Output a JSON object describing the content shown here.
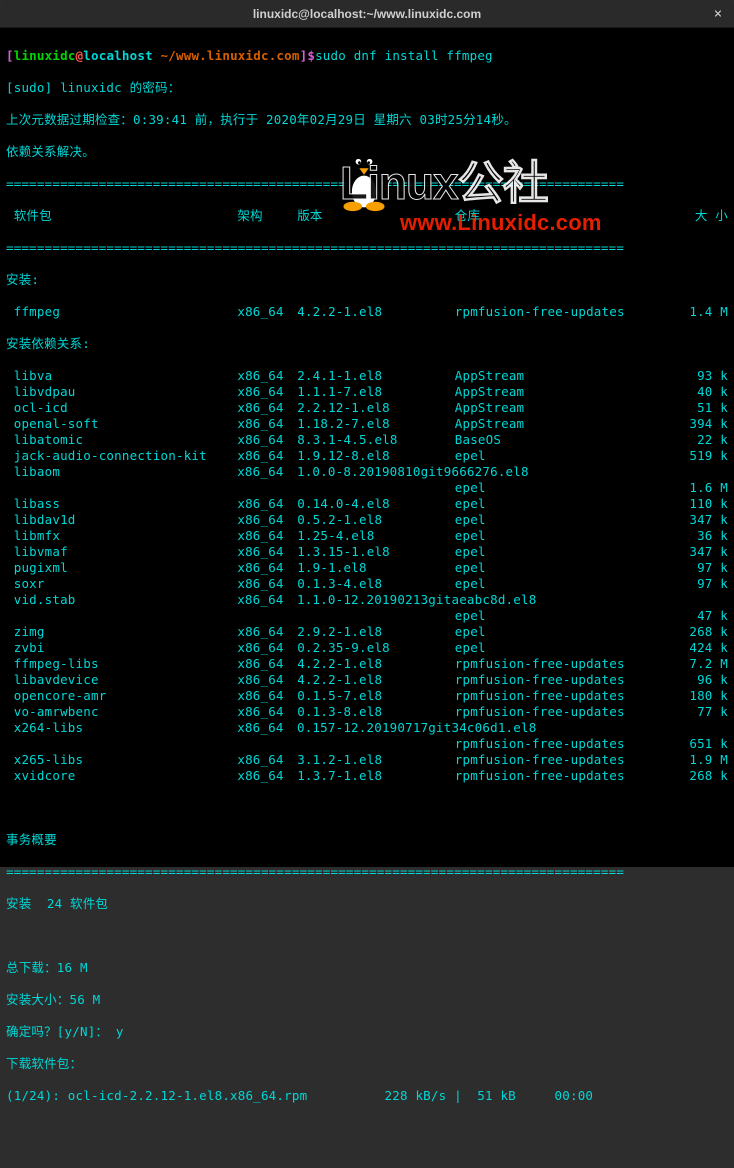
{
  "titlebar": {
    "title": "linuxidc@localhost:~/www.linuxidc.com",
    "close": "×"
  },
  "prompt": {
    "lb": "[",
    "user": "linuxidc",
    "at": "@",
    "host": "localhost",
    "path": " ~/www.linuxidc.com",
    "rb": "]",
    "dollar": "$",
    "command": "sudo dnf install ffmpeg"
  },
  "lines": {
    "sudo_prompt": "[sudo] linuxidc 的密码：",
    "meta": "上次元数据过期检查：0:39:41 前，执行于 2020年02月29日 星期六 03时25分14秒。",
    "deps": "依赖关系解决。",
    "headers": {
      "pkg": " 软件包",
      "arch": "架构",
      "ver": "版本",
      "repo": "仓库",
      "size": "大 小"
    },
    "section_install": "安装:",
    "section_deps": "安装依赖关系:",
    "txn_title": "事务概要",
    "install_count": "安装  24 软件包",
    "total_dl": "总下载：16 M",
    "install_size": "安装大小：56 M",
    "confirm": "确定吗？[y/N]： y",
    "downloading": "下载软件包：",
    "progress": "(1/24): ocl-icd-2.2.12-1.el8.x86_64.rpm          228 kB/s |  51 kB     00:00"
  },
  "sep": "================================================================================",
  "packages": {
    "main": [
      {
        "name": " ffmpeg",
        "arch": "x86_64",
        "ver": "4.2.2-1.el8",
        "repo": "rpmfusion-free-updates",
        "size": "1.4 M"
      }
    ],
    "deps": [
      {
        "name": " libva",
        "arch": "x86_64",
        "ver": "2.4.1-1.el8",
        "repo": "AppStream",
        "size": "93 k"
      },
      {
        "name": " libvdpau",
        "arch": "x86_64",
        "ver": "1.1.1-7.el8",
        "repo": "AppStream",
        "size": "40 k"
      },
      {
        "name": " ocl-icd",
        "arch": "x86_64",
        "ver": "2.2.12-1.el8",
        "repo": "AppStream",
        "size": "51 k"
      },
      {
        "name": " openal-soft",
        "arch": "x86_64",
        "ver": "1.18.2-7.el8",
        "repo": "AppStream",
        "size": "394 k"
      },
      {
        "name": " libatomic",
        "arch": "x86_64",
        "ver": "8.3.1-4.5.el8",
        "repo": "BaseOS",
        "size": "22 k"
      },
      {
        "name": " jack-audio-connection-kit",
        "arch": "x86_64",
        "ver": "1.9.12-8.el8",
        "repo": "epel",
        "size": "519 k"
      },
      {
        "name": " libaom",
        "arch": "x86_64",
        "ver": "1.0.0-8.20190810git9666276.el8",
        "repo": "",
        "size": ""
      },
      {
        "name": "",
        "arch": "",
        "ver": "",
        "repo": "epel",
        "size": "1.6 M"
      },
      {
        "name": " libass",
        "arch": "x86_64",
        "ver": "0.14.0-4.el8",
        "repo": "epel",
        "size": "110 k"
      },
      {
        "name": " libdav1d",
        "arch": "x86_64",
        "ver": "0.5.2-1.el8",
        "repo": "epel",
        "size": "347 k"
      },
      {
        "name": " libmfx",
        "arch": "x86_64",
        "ver": "1.25-4.el8",
        "repo": "epel",
        "size": "36 k"
      },
      {
        "name": " libvmaf",
        "arch": "x86_64",
        "ver": "1.3.15-1.el8",
        "repo": "epel",
        "size": "347 k"
      },
      {
        "name": " pugixml",
        "arch": "x86_64",
        "ver": "1.9-1.el8",
        "repo": "epel",
        "size": "97 k"
      },
      {
        "name": " soxr",
        "arch": "x86_64",
        "ver": "0.1.3-4.el8",
        "repo": "epel",
        "size": "97 k"
      },
      {
        "name": " vid.stab",
        "arch": "x86_64",
        "ver": "1.1.0-12.20190213gitaeabc8d.el8",
        "repo": "",
        "size": ""
      },
      {
        "name": "",
        "arch": "",
        "ver": "",
        "repo": "epel",
        "size": "47 k"
      },
      {
        "name": " zimg",
        "arch": "x86_64",
        "ver": "2.9.2-1.el8",
        "repo": "epel",
        "size": "268 k"
      },
      {
        "name": " zvbi",
        "arch": "x86_64",
        "ver": "0.2.35-9.el8",
        "repo": "epel",
        "size": "424 k"
      },
      {
        "name": " ffmpeg-libs",
        "arch": "x86_64",
        "ver": "4.2.2-1.el8",
        "repo": "rpmfusion-free-updates",
        "size": "7.2 M"
      },
      {
        "name": " libavdevice",
        "arch": "x86_64",
        "ver": "4.2.2-1.el8",
        "repo": "rpmfusion-free-updates",
        "size": "96 k"
      },
      {
        "name": " opencore-amr",
        "arch": "x86_64",
        "ver": "0.1.5-7.el8",
        "repo": "rpmfusion-free-updates",
        "size": "180 k"
      },
      {
        "name": " vo-amrwbenc",
        "arch": "x86_64",
        "ver": "0.1.3-8.el8",
        "repo": "rpmfusion-free-updates",
        "size": "77 k"
      },
      {
        "name": " x264-libs",
        "arch": "x86_64",
        "ver": "0.157-12.20190717git34c06d1.el8",
        "repo": "",
        "size": ""
      },
      {
        "name": "",
        "arch": "",
        "ver": "",
        "repo": "rpmfusion-free-updates",
        "size": "651 k"
      },
      {
        "name": " x265-libs",
        "arch": "x86_64",
        "ver": "3.1.2-1.el8",
        "repo": "rpmfusion-free-updates",
        "size": "1.9 M"
      },
      {
        "name": " xvidcore",
        "arch": "x86_64",
        "ver": "1.3.7-1.el8",
        "repo": "rpmfusion-free-updates",
        "size": "268 k"
      }
    ]
  },
  "watermark": {
    "big": "Linux公社",
    "url": "www.Linuxidc.com"
  }
}
